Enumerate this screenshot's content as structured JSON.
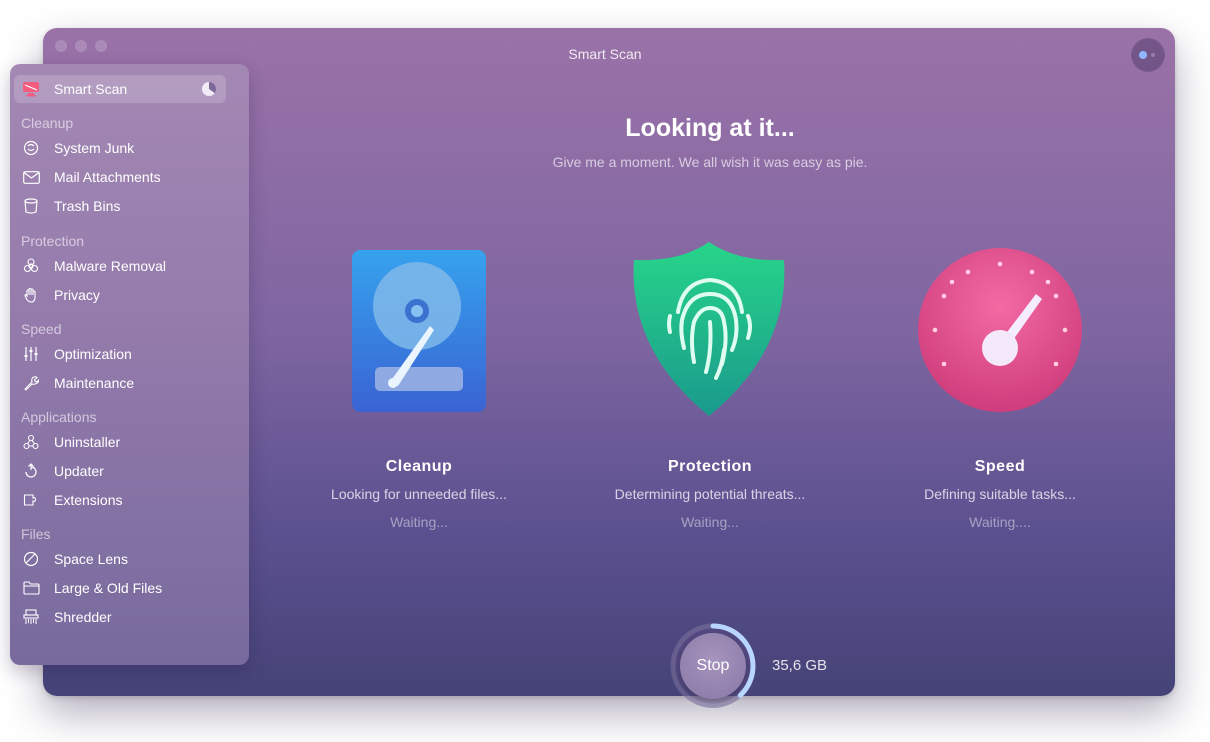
{
  "window": {
    "title": "Smart Scan"
  },
  "sidebar": {
    "smart_scan": "Smart Scan",
    "sections": [
      {
        "heading": "Cleanup",
        "items": [
          "System Junk",
          "Mail Attachments",
          "Trash Bins"
        ]
      },
      {
        "heading": "Protection",
        "items": [
          "Malware Removal",
          "Privacy"
        ]
      },
      {
        "heading": "Speed",
        "items": [
          "Optimization",
          "Maintenance"
        ]
      },
      {
        "heading": "Applications",
        "items": [
          "Uninstaller",
          "Updater",
          "Extensions"
        ]
      },
      {
        "heading": "Files",
        "items": [
          "Space Lens",
          "Large & Old Files",
          "Shredder"
        ]
      }
    ],
    "icons": {
      "smart_scan": "monitor-icon",
      "system_junk": "junk-icon",
      "mail": "envelope-icon",
      "trash": "trash-icon",
      "malware": "biohazard-icon",
      "privacy": "hand-icon",
      "optimization": "sliders-icon",
      "maintenance": "wrench-icon",
      "uninstaller": "uninstaller-icon",
      "updater": "update-icon",
      "extensions": "extensions-icon",
      "space_lens": "lens-icon",
      "large_files": "folder-icon",
      "shredder": "shredder-icon"
    }
  },
  "main": {
    "headline": "Looking at it...",
    "subline": "Give me a moment. We all wish it was easy as pie.",
    "modules": [
      {
        "title": "Cleanup",
        "desc": "Looking for unneeded files...",
        "status": "Waiting..."
      },
      {
        "title": "Protection",
        "desc": "Determining potential threats...",
        "status": "Waiting..."
      },
      {
        "title": "Speed",
        "desc": "Defining suitable tasks...",
        "status": "Waiting...."
      }
    ]
  },
  "footer": {
    "stop_label": "Stop",
    "size": "35,6 GB",
    "scan_progress": 0.38
  },
  "colors": {
    "cleanup_blue": "#3a8fe0",
    "protection_green": "#2fcf8a",
    "speed_pink": "#e84f8c",
    "ring_accent": "#b9d6ff"
  }
}
